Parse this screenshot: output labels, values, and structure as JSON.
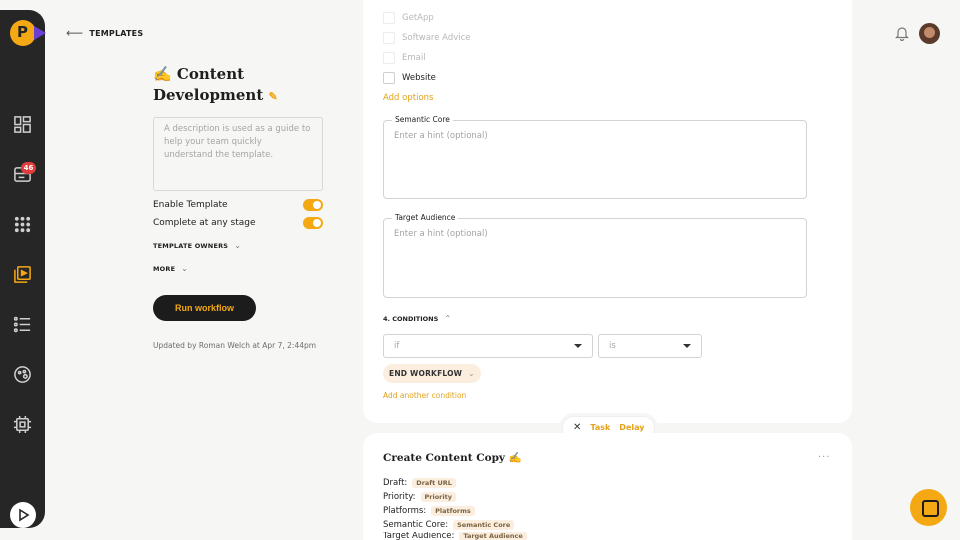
{
  "breadcrumb": {
    "label": "TEMPLATES"
  },
  "rail": {
    "notification_count": "46"
  },
  "template": {
    "title": "✍️ Content Development",
    "description_placeholder": "A description is used as a guide to help your team quickly understand the template.",
    "enable_label": "Enable Template",
    "complete_label": "Complete at any stage",
    "owners_label": "TEMPLATE OWNERS",
    "more_label": "MORE",
    "run_label": "Run workflow",
    "updated_text": "Updated by Roman Welch at Apr 7, 2:44pm"
  },
  "options": {
    "items": [
      "GetApp",
      "Software Advice",
      "Email",
      "Website"
    ],
    "add_label": "Add options"
  },
  "fields": [
    {
      "label": "Semantic Core",
      "hint": "Enter a hint (optional)"
    },
    {
      "label": "Target Audience",
      "hint": "Enter a hint (optional)"
    }
  ],
  "conditions": {
    "title": "4. CONDITIONS",
    "if_placeholder": "if",
    "is_placeholder": "is",
    "action_label": "END WORKFLOW",
    "add_label": "Add another condition"
  },
  "connector": {
    "close": "✕",
    "task": "Task",
    "delay": "Delay"
  },
  "next_card": {
    "title": "Create Content Copy ✍️",
    "menu": "···",
    "props": [
      {
        "label": "Draft:",
        "tag": "Draft URL"
      },
      {
        "label": "Priority:",
        "tag": "Priority"
      },
      {
        "label": "Platforms:",
        "tag": "Platforms"
      },
      {
        "label": "Semantic Core:",
        "tag": "Semantic Core"
      },
      {
        "label": "Target Audience:",
        "tag": "Target Audience"
      }
    ]
  },
  "colors": {
    "accent": "#f4a914",
    "rail": "#262626",
    "badge": "#e03d3d"
  }
}
